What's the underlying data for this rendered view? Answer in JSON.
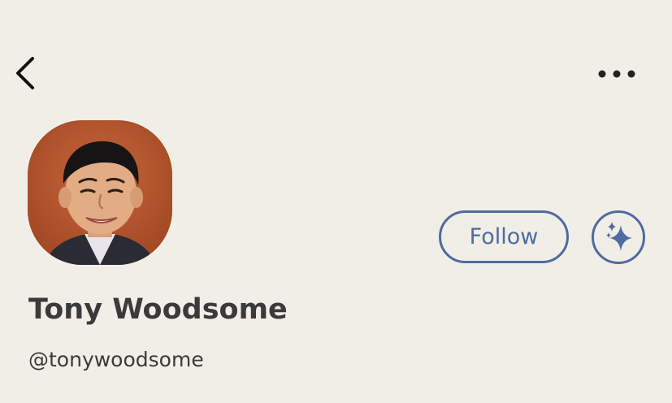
{
  "nav": {
    "back_icon": "chevron-left-icon",
    "more_icon": "more-horizontal-icon"
  },
  "profile": {
    "display_name": "Tony Woodsome",
    "username": "@tonywoodsome"
  },
  "actions": {
    "follow_label": "Follow",
    "sparkle_icon": "sparkle-icon"
  },
  "colors": {
    "background": "#f1eee7",
    "accent": "#4f6b9f",
    "text": "#3a3a3a"
  }
}
